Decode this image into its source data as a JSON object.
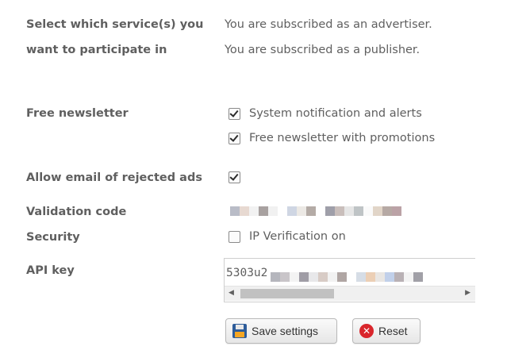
{
  "services": {
    "label_line1": "Select which service(s) you",
    "label_line2": "want to participate in",
    "advertiser_status": "You are subscribed as an advertiser.",
    "publisher_status": "You are subscribed as a publisher."
  },
  "newsletter": {
    "label": "Free newsletter",
    "options": [
      {
        "label": "System notification and alerts",
        "checked": true
      },
      {
        "label": "Free newsletter with promotions",
        "checked": true
      }
    ]
  },
  "rejected_ads": {
    "label": "Allow email of rejected ads",
    "checked": true
  },
  "validation": {
    "label": "Validation code",
    "value_redacted": true
  },
  "security": {
    "label": "Security",
    "ip_verification_label": "IP Verification on",
    "ip_verification_checked": false
  },
  "api_key": {
    "label": "API key",
    "visible_prefix": "5303u2",
    "rest_redacted": true
  },
  "buttons": {
    "save_label": "Save settings",
    "reset_label": "Reset"
  },
  "colors": {
    "label_text": "#5f5f5f",
    "reset_icon": "#d9262c",
    "save_icon": "#2d5c9a"
  },
  "icons": {
    "save": "floppy-disk-icon",
    "reset": "close-circle-icon"
  }
}
